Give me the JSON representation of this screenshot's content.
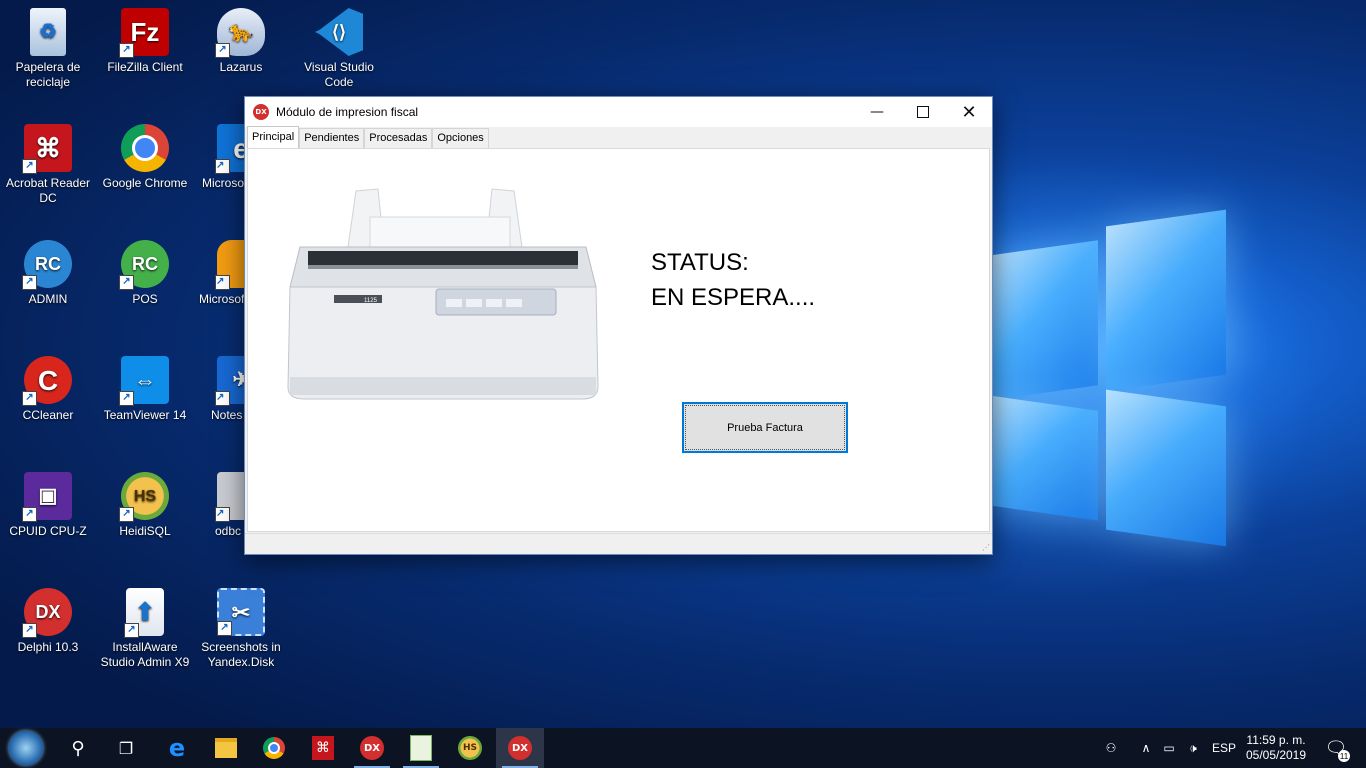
{
  "desktop": {
    "icons": [
      {
        "label": "Papelera de reciclaje",
        "icon": "recycle-bin-icon"
      },
      {
        "label": "FileZilla Client",
        "icon": "filezilla-icon"
      },
      {
        "label": "Lazarus",
        "icon": "lazarus-icon"
      },
      {
        "label": "Visual Studio Code",
        "icon": "vscode-icon"
      },
      {
        "label": "Acrobat Reader DC",
        "icon": "acrobat-icon"
      },
      {
        "label": "Google Chrome",
        "icon": "chrome-icon"
      },
      {
        "label": "Microsoft Edge",
        "icon": "edge-icon"
      },
      {
        "label": "ADMIN",
        "icon": "rc-admin-icon"
      },
      {
        "label": "POS",
        "icon": "rc-pos-icon"
      },
      {
        "label": "Microsoft FoxPro",
        "icon": "foxpro-icon"
      },
      {
        "label": "CCleaner",
        "icon": "ccleaner-icon"
      },
      {
        "label": "TeamViewer 14",
        "icon": "teamviewer-icon"
      },
      {
        "label": "Notes Yandex",
        "icon": "yandex-notes-icon"
      },
      {
        "label": "CPUID CPU-Z",
        "icon": "cpuz-icon"
      },
      {
        "label": "HeidiSQL",
        "icon": "heidisql-icon"
      },
      {
        "label": "odbc",
        "icon": "odbc-icon"
      },
      {
        "label": "Delphi 10.3",
        "icon": "delphi-icon"
      },
      {
        "label": "InstallAware Studio Admin X9",
        "icon": "installaware-icon"
      },
      {
        "label": "Screenshots in Yandex.Disk",
        "icon": "screenshots-icon"
      }
    ]
  },
  "window": {
    "title": "Módulo de impresion fiscal",
    "tabs": [
      "Principal",
      "Pendientes",
      "Procesadas",
      "Opciones"
    ],
    "status_label": "STATUS:",
    "status_value": "EN ESPERA....",
    "test_button": "Prueba Factura",
    "printer_model": "1125"
  },
  "taskbar": {
    "apps": [
      "start-icon",
      "search-icon",
      "task-view-icon",
      "edge-icon",
      "file-explorer-icon",
      "chrome-icon",
      "acrobat-icon",
      "delphi-icon",
      "notepadpp-icon",
      "heidisql-icon",
      "delphi-app-icon"
    ],
    "language": "ESP",
    "time": "11:59 p. m.",
    "date": "05/05/2019",
    "notification_count": "11"
  },
  "colors": {
    "accent": "#0078d7",
    "taskbar": "#0c1424",
    "delphi_red": "#d32f2f"
  }
}
